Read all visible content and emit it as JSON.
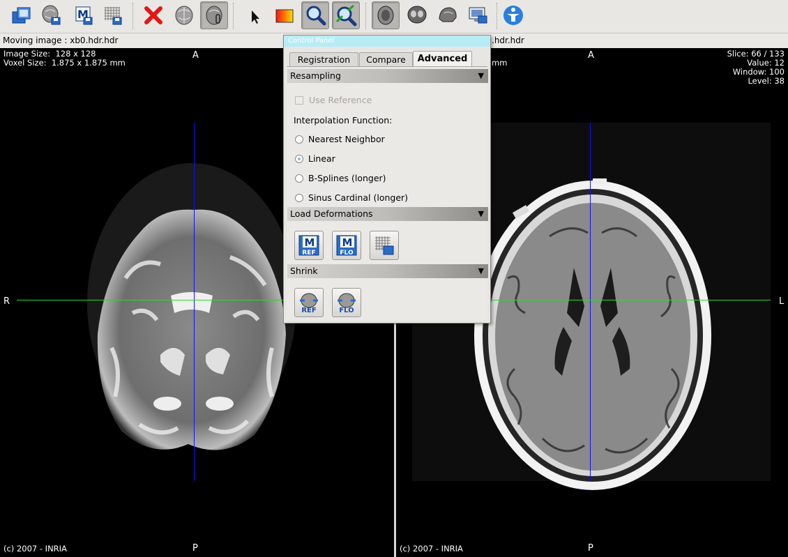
{
  "toolbar": {
    "buttons": [
      {
        "icon": "open-images-icon"
      },
      {
        "icon": "save-brain-icon"
      },
      {
        "icon": "save-matrix-icon"
      },
      {
        "icon": "save-deformation-icon"
      },
      {
        "icon": "close-icon"
      },
      {
        "icon": "brain-icon"
      },
      {
        "icon": "brain-link-icon"
      },
      {
        "icon": "pointer-icon"
      },
      {
        "icon": "window-level-icon"
      },
      {
        "icon": "zoom-icon"
      },
      {
        "icon": "zoom-fit-icon"
      },
      {
        "icon": "axial-view-icon"
      },
      {
        "icon": "coronal-view-icon"
      },
      {
        "icon": "sagittal-view-icon"
      },
      {
        "icon": "screenshot-icon"
      },
      {
        "icon": "help-icon"
      }
    ]
  },
  "labels": {
    "moving": "Moving image : xb0.hdr.hdr",
    "fixed_suffix": ".hdr.hdr"
  },
  "left_view": {
    "image_size": "Image Size:  128 x 128",
    "voxel_size": "Voxel Size:  1.875 x 1.875 mm",
    "orient_top": "A",
    "orient_bottom": "P",
    "orient_left": "R",
    "copyright": "(c) 2007 - INRIA"
  },
  "right_view": {
    "voxel_suffix": "mm",
    "slice": "Slice: 66 / 133",
    "value": "Value: 12",
    "window": "Window: 100",
    "level": "Level: 38",
    "orient_top": "A",
    "orient_bottom": "P",
    "orient_right": "L",
    "copyright": "(c) 2007 - INRIA"
  },
  "panel": {
    "title": "Control Panel",
    "tabs": [
      "Registration",
      "Compare",
      "Advanced"
    ],
    "active_tab": "Advanced",
    "resampling": {
      "header": "Resampling",
      "use_reference": "Use Reference",
      "interp_label": "Interpolation Function:",
      "options": [
        "Nearest Neighbor",
        "Linear",
        "B-Splines (longer)",
        "Sinus Cardinal (longer)"
      ],
      "selected": "Linear"
    },
    "load_deformations": {
      "header": "Load Deformations",
      "buttons": [
        {
          "icon": "load-matrix-ref-icon",
          "tag": "REF",
          "letter": "M"
        },
        {
          "icon": "load-matrix-flo-icon",
          "tag": "FLO",
          "letter": "M"
        },
        {
          "icon": "load-deformation-field-icon"
        }
      ]
    },
    "shrink": {
      "header": "Shrink",
      "buttons": [
        {
          "icon": "shrink-ref-icon",
          "tag": "REF"
        },
        {
          "icon": "shrink-flo-icon",
          "tag": "FLO"
        }
      ]
    }
  },
  "colors": {
    "crosshair_vertical": "#1010ff",
    "crosshair_horizontal": "#20e020",
    "panel_title_bar": "#b8ecf4",
    "view_background": "#000000"
  }
}
